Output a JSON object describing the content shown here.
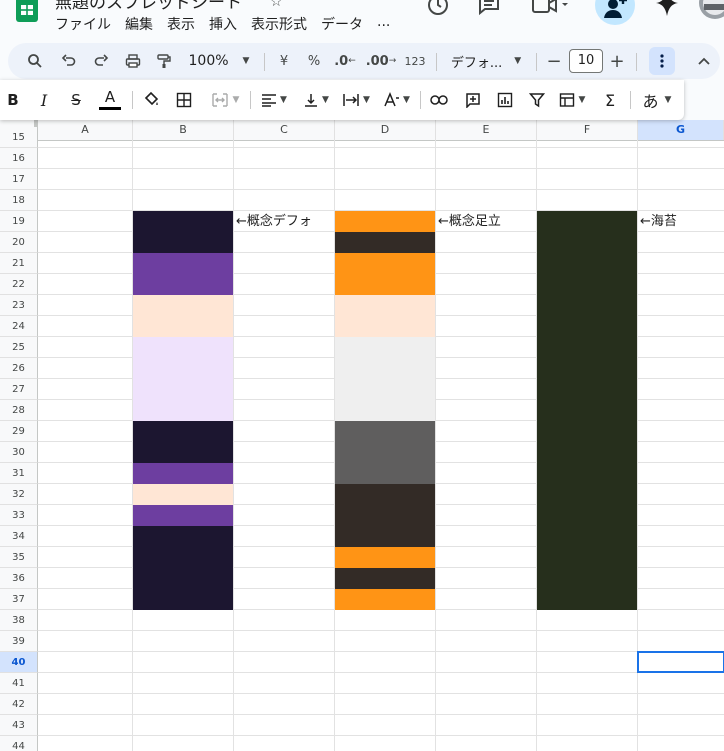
{
  "app": {
    "doc_title": "無題のスプレッドシート",
    "menus": [
      "ファイル",
      "編集",
      "表示",
      "挿入",
      "表示形式",
      "データ",
      "..."
    ]
  },
  "toolbar": {
    "zoom": "100%",
    "currency": "¥",
    "percent": "%",
    "decrease_decimal": ".0",
    "increase_decimal": ".00",
    "number_format": "123",
    "font_family": "デフォ...",
    "font_size_minus": "−",
    "font_size": "10",
    "font_size_plus": "+",
    "text_color_accent": "#000000",
    "input_tools": "あ"
  },
  "grid": {
    "columns": [
      "A",
      "B",
      "C",
      "D",
      "E",
      "F",
      "G"
    ],
    "selected_column": "G",
    "rows": [
      "15",
      "16",
      "17",
      "18",
      "19",
      "20",
      "21",
      "22",
      "23",
      "24",
      "25",
      "26",
      "27",
      "28",
      "29",
      "30",
      "31",
      "32",
      "33",
      "34",
      "35",
      "36",
      "37",
      "38",
      "39",
      "40",
      "41",
      "42",
      "43",
      "44"
    ],
    "selected_row": "40",
    "active_cell": "G40",
    "notes": [
      {
        "cell": "C19",
        "text": "←概念デフォ"
      },
      {
        "cell": "E19",
        "text": "←概念足立"
      },
      {
        "cell": "G19",
        "text": "←海苔"
      }
    ],
    "palettes": {
      "B": [
        "#1c1630",
        "#1c1630",
        "#6d3ea0",
        "#6d3ea0",
        "#ffe6d5",
        "#ffe6d5",
        "#efe2fc",
        "#efe2fc",
        "#efe2fc",
        "#efe2fc",
        "#1c1630",
        "#1c1630",
        "#6d3ea0",
        "#ffe6d5",
        "#6d3ea0",
        "#1c1630",
        "#1c1630",
        "#1c1630",
        "#1c1630"
      ],
      "D": [
        "#ff9415",
        "#332b26",
        "#ff9415",
        "#ff9415",
        "#ffe6d5",
        "#ffe6d5",
        "#efefef",
        "#efefef",
        "#efefef",
        "#efefef",
        "#5f5e5e",
        "#5f5e5e",
        "#5f5e5e",
        "#332b26",
        "#332b26",
        "#332b26",
        "#ff9415",
        "#332b26",
        "#ff9415"
      ],
      "F": [
        "#262f1c",
        "#262f1c",
        "#262f1c",
        "#262f1c",
        "#262f1c",
        "#262f1c",
        "#262f1c",
        "#262f1c",
        "#262f1c",
        "#262f1c",
        "#262f1c",
        "#262f1c",
        "#262f1c",
        "#262f1c",
        "#262f1c",
        "#262f1c",
        "#262f1c",
        "#262f1c",
        "#262f1c"
      ]
    }
  },
  "colors": {
    "accent": "#0b57d0",
    "selection_bg": "#d3e3fd",
    "toolbar_bg": "#edf2fa"
  }
}
